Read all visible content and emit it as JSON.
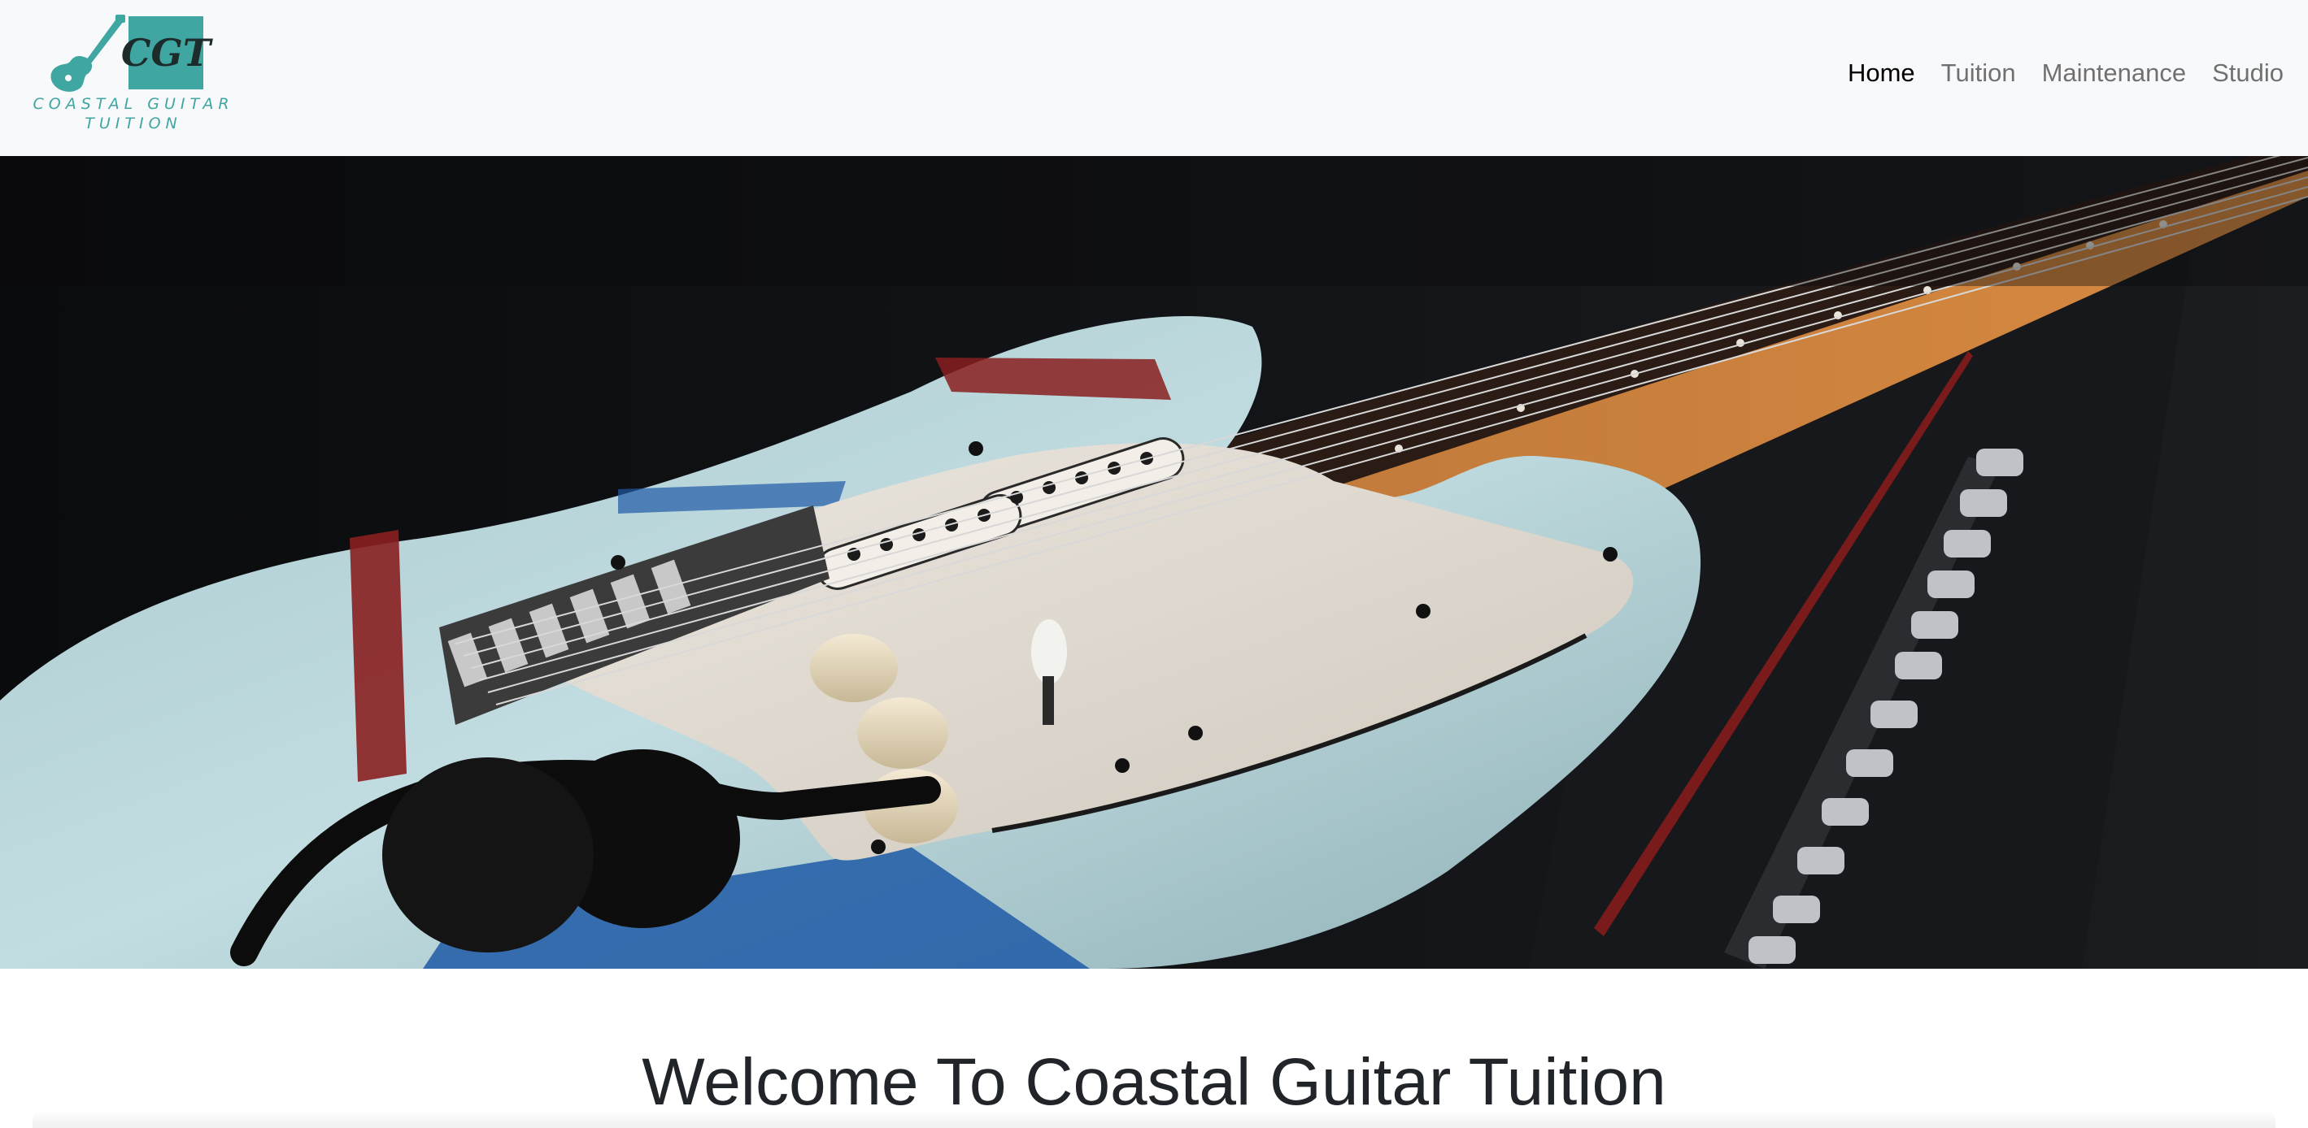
{
  "brand": {
    "logo_monogram": "CGT",
    "logo_wordmark_line1": "COASTAL GUITAR",
    "logo_wordmark_line2": "TUITION",
    "accent_color": "#3fa6a2"
  },
  "nav": {
    "items": [
      {
        "label": "Home",
        "active": true
      },
      {
        "label": "Tuition",
        "active": false
      },
      {
        "label": "Maintenance",
        "active": false
      },
      {
        "label": "Studio",
        "active": false
      }
    ]
  },
  "hero": {
    "image_subject": "electric-guitar-photo"
  },
  "main": {
    "heading": "Welcome To Coastal Guitar Tuition"
  }
}
